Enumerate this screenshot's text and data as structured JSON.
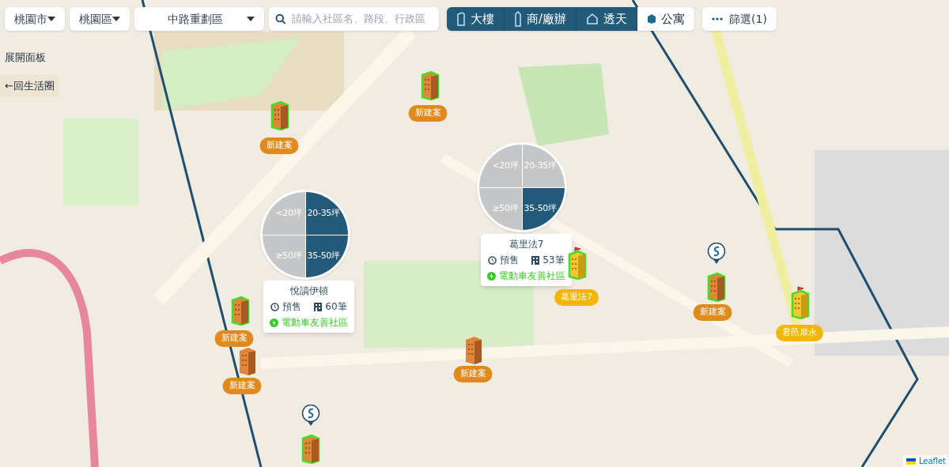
{
  "filters": {
    "city": "桃園市",
    "district": "桃園區",
    "zone": "中路重劃區",
    "search": {
      "placeholder": "請輸入社區名、路段、行政區"
    }
  },
  "types": [
    {
      "kind": "tower",
      "label": "大樓",
      "selected": true
    },
    {
      "kind": "office",
      "label": "商/廠辦",
      "selected": true
    },
    {
      "kind": "house",
      "label": "透天",
      "selected": true
    },
    {
      "kind": "apartment",
      "label": "公寓",
      "selected": false
    }
  ],
  "filter_button": {
    "label": "篩選(1)"
  },
  "side_panel": {
    "expand": "展開面板",
    "back": "←回生活圈"
  },
  "clusters": [
    {
      "slices": [
        {
          "label": "<20坪",
          "selected": false
        },
        {
          "label": "20-35坪",
          "selected": true
        },
        {
          "label": "≥50坪",
          "selected": false
        },
        {
          "label": "35-50坪",
          "selected": true
        }
      ],
      "popup": {
        "name": "悅讀伊頓",
        "status": "預售",
        "count": "60筆",
        "tag": "電動車友善社區"
      }
    },
    {
      "slices": [
        {
          "label": "<20坪",
          "selected": false
        },
        {
          "label": "20-35坪",
          "selected": false
        },
        {
          "label": "≥50坪",
          "selected": false
        },
        {
          "label": "35-50坪",
          "selected": true
        }
      ],
      "popup": {
        "name": "葛里法7",
        "status": "預售",
        "count": "53筆",
        "tag": "電動車友善社區"
      }
    }
  ],
  "markers": [
    {
      "kind": "new",
      "label": "新建案",
      "highlighted": true,
      "badge": false
    },
    {
      "kind": "new",
      "label": "新建案",
      "highlighted": true,
      "badge": false
    },
    {
      "kind": "new",
      "label": "新建案",
      "highlighted": true,
      "badge": false
    },
    {
      "kind": "new",
      "label": "新建案",
      "highlighted": false,
      "badge": false
    },
    {
      "kind": "new",
      "label": "新建案",
      "highlighted": false,
      "badge": false
    },
    {
      "kind": "new",
      "label": "新建案",
      "highlighted": true,
      "badge": true
    },
    {
      "kind": "presale",
      "label": "葛里法7",
      "highlighted": true,
      "badge": false
    },
    {
      "kind": "presale",
      "label": "君邑扉永",
      "highlighted": true,
      "badge": false
    },
    {
      "kind": "new",
      "highlighted": true,
      "badge": true
    }
  ],
  "attribution": "Leaflet"
}
